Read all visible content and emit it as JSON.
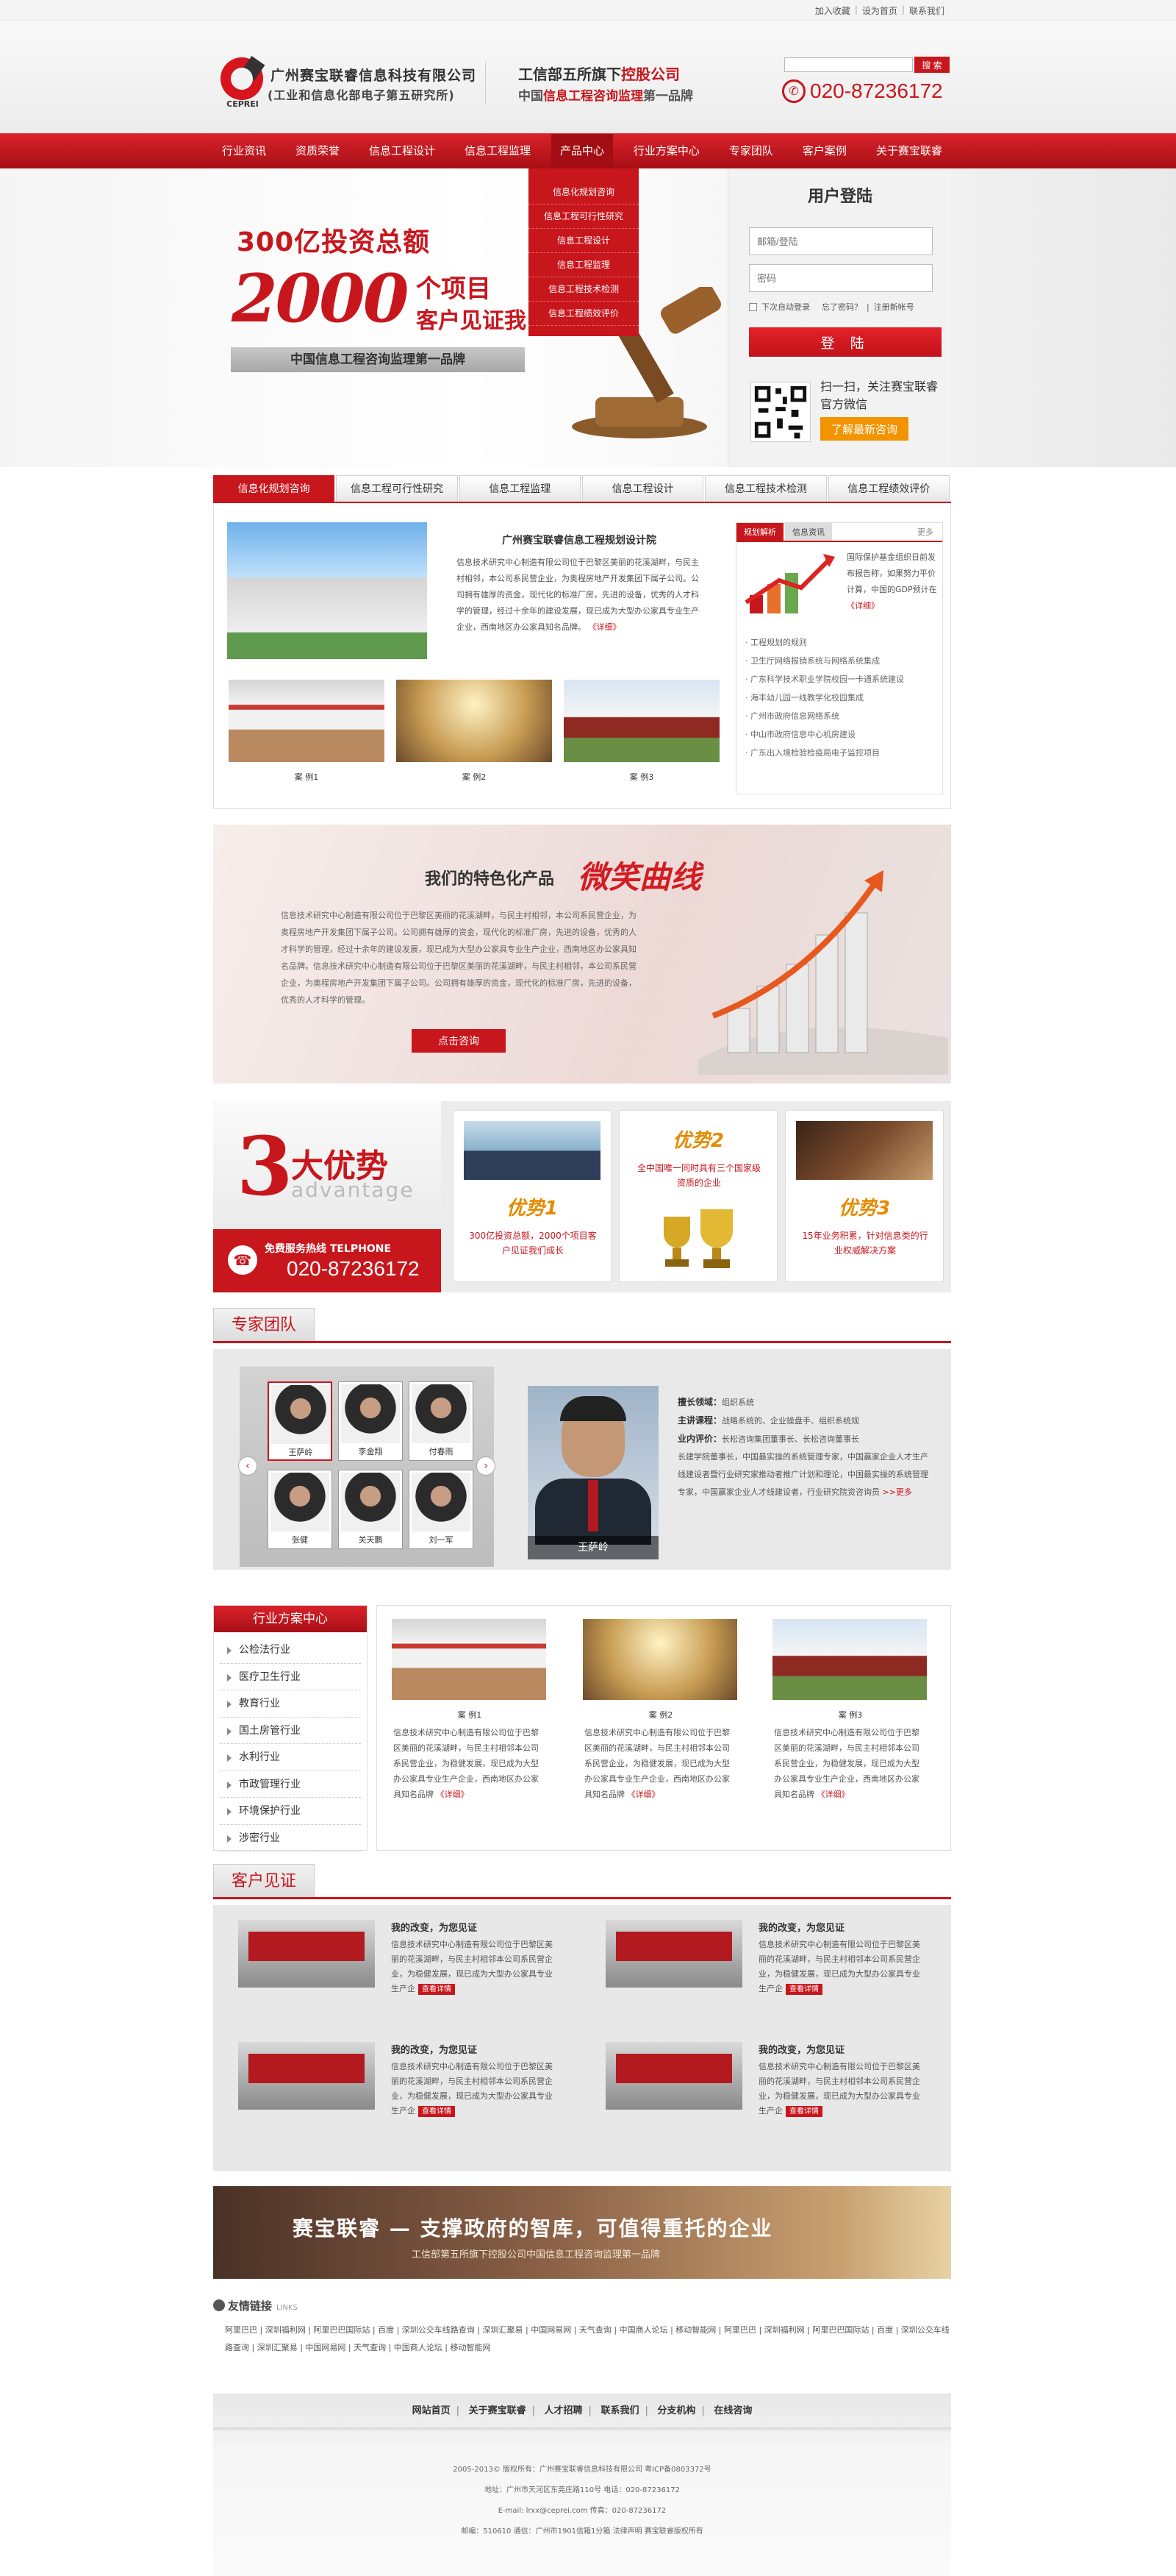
{
  "topbar": {
    "links": [
      "加入收藏",
      "设为首页",
      "联系我们"
    ]
  },
  "header": {
    "logo_abbr": "CEPREI",
    "company_name": "广州赛宝联睿信息科技有限公司",
    "company_sub": "(工业和信息化部电子第五研究所)",
    "slogan_line1_a": "工信部五所旗下",
    "slogan_line1_b": "控股公司",
    "slogan_line2_a": "中国",
    "slogan_line2_b": "信息工程咨询监理",
    "slogan_line2_c": "第一品牌",
    "search_button": "搜 索",
    "phone": "020-87236172"
  },
  "nav": {
    "items": [
      "行业资讯",
      "资质荣誉",
      "信息工程设计",
      "信息工程监理",
      "产品中心",
      "行业方案中心",
      "专家团队",
      "客户案例",
      "关于赛宝联睿"
    ],
    "active_index": 4
  },
  "dropdown": {
    "items": [
      "信息化规划咨询",
      "信息工程可行性研究",
      "信息工程设计",
      "信息工程监理",
      "信息工程技术检测",
      "信息工程绩效评价"
    ]
  },
  "banner": {
    "line1": "300亿投资总额",
    "big_number": "2000",
    "line2": "个项目",
    "line3_a": "客户见",
    "line3_b": "证我",
    "bar_text": "中国信息工程咨询监理第一品牌"
  },
  "login": {
    "title": "用户登陆",
    "username_placeholder": "邮箱/登陆",
    "password_placeholder": "密码",
    "remember": "下次自动登录",
    "forgot": "忘了密码？",
    "register": "注册新帐号",
    "submit": "登 陆",
    "qr_text": "扫一扫，关注赛宝联睿官方微信",
    "qr_button": "了解最新咨询"
  },
  "service_tabs": {
    "items": [
      "信息化规划咨询",
      "信息工程可行性研究",
      "信息工程监理",
      "信息工程设计",
      "信息工程技术检测",
      "信息工程绩效评价"
    ],
    "active_index": 0
  },
  "info": {
    "title": "广州赛宝联睿信息工程规划设计院",
    "text": "信息技术研究中心制造有限公司位于巴黎区美丽的花溪湖畔，与民主村相邻，本公司系民营企业，为奥程房地产开发集团下属子公司。公司拥有雄厚的资金，现代化的标准厂房，先进的设备，优秀的人才科学的管理，经过十余年的建设发展，现已成为大型办公家具专业生产企业，西南地区办公家具知名品牌。",
    "more": "《详细》",
    "cases": [
      "案 例1",
      "案 例2",
      "案 例3"
    ]
  },
  "news": {
    "tabs": [
      "规划解析",
      "信息资讯"
    ],
    "tab_more": "更多",
    "intro": "国际保护基金组织日前发布报告称，如果努力平价计算，中国的GDP预计在",
    "intro_more": "《详细》",
    "items": [
      "工程规划的规则",
      "卫生厅网络报销系统与网络系统集成",
      "广东科学技术职业学院校园一卡通系统建设",
      "海丰幼儿园一线教学化校园集成",
      "广州市政府信息网络系统",
      "中山市政府信息中心机房建设",
      "广东出入境检验检疫局电子监控项目"
    ]
  },
  "smile": {
    "title": "我们的特色化产品",
    "big": "微笑曲线",
    "text": "信息技术研究中心制造有限公司位于巴黎区美丽的花溪湖畔，与民主村相邻，本公司系民营企业，为奥程房地产开发集团下属子公司。公司拥有雄厚的资金，现代化的标准厂房，先进的设备，优秀的人才科学的管理，经过十余年的建设发展，现已成为大型办公家具专业生产企业，西南地区办公家具知名品牌。信息技术研究中心制造有限公司位于巴黎区美丽的花溪湖畔，与民主村相邻，本公司系民营企业，为奥程房地产开发集团下属子公司。公司拥有雄厚的资金，现代化的标准厂房，先进的设备，优秀的人才科学的管理。",
    "button": "点击咨询"
  },
  "advantages": {
    "num": "3",
    "title": "大优势",
    "en": "advantage",
    "hotline_label": "免费服务热线 TELPHONE",
    "hotline": "020-87236172",
    "items": [
      {
        "title": "优势1",
        "text": "300亿投资总额，2000个项目客户见证我们成长"
      },
      {
        "title": "优势2",
        "text": "全中国唯一同时具有三个国家级资质的企业"
      },
      {
        "title": "优势3",
        "text": "15年业务积累，针对信息类的行业权威解决方案"
      }
    ]
  },
  "experts": {
    "section_title": "专家团队",
    "thumbs": [
      "王萨岭",
      "李金翔",
      "付春雨",
      "张健",
      "关天鹏",
      "刘一军"
    ],
    "featured_name": "王萨岭",
    "field_label": "擅长领域：",
    "field": "组织系统",
    "courses_label": "主讲课程：",
    "courses": "战略系统的、企业操盘手、组织系统规",
    "title_label": "业内评价：",
    "title_text": "长松咨询集团董事长、长松咨询董事长",
    "bio": "长建学院董事长，中国最实操的系统管理专家，中国赢家企业人才生产线建设者暨行业研究家推动者推广计划和理论，中国最实操的系统管理专家，中国赢家企业人才线建设者，行业研究院资咨询员",
    "more": ">>更多"
  },
  "industries": {
    "title": "行业方案中心",
    "items": [
      "公检法行业",
      "医疗卫生行业",
      "教育行业",
      "国土房管行业",
      "水利行业",
      "市政管理行业",
      "环境保护行业",
      "涉密行业"
    ],
    "cases": [
      {
        "label": "案 例1",
        "text": "信息技术研究中心制造有限公司位于巴黎区美丽的花溪湖畔，与民主村相邻本公司系民营企业，为稳健发展，现已成为大型办公家具专业生产企业，西南地区办公家具知名品牌"
      },
      {
        "label": "案 例2",
        "text": "信息技术研究中心制造有限公司位于巴黎区美丽的花溪湖畔，与民主村相邻本公司系民营企业，为稳健发展，现已成为大型办公家具专业生产企业，西南地区办公家具知名品牌"
      },
      {
        "label": "案 例3",
        "text": "信息技术研究中心制造有限公司位于巴黎区美丽的花溪湖畔，与民主村相邻本公司系民营企业，为稳健发展，现已成为大型办公家具专业生产企业，西南地区办公家具知名品牌"
      }
    ],
    "more": "《详细》"
  },
  "testimonials": {
    "section_title": "客户见证",
    "items": [
      {
        "title": "我的改变，为您见证",
        "text": "信息技术研究中心制造有限公司位于巴黎区美丽的花溪湖畔，与民主村相邻本公司系民营企业，为稳健发展，现已成为大型办公家具专业生产企"
      },
      {
        "title": "我的改变，为您见证",
        "text": "信息技术研究中心制造有限公司位于巴黎区美丽的花溪湖畔，与民主村相邻本公司系民营企业，为稳健发展，现已成为大型办公家具专业生产企"
      },
      {
        "title": "我的改变，为您见证",
        "text": "信息技术研究中心制造有限公司位于巴黎区美丽的花溪湖畔，与民主村相邻本公司系民营企业，为稳健发展，现已成为大型办公家具专业生产企"
      },
      {
        "title": "我的改变，为您见证",
        "text": "信息技术研究中心制造有限公司位于巴黎区美丽的花溪湖畔，与民主村相邻本公司系民营企业，为稳健发展，现已成为大型办公家具专业生产企"
      }
    ],
    "button": "查看详情"
  },
  "bottom_banner": {
    "title": "赛宝联睿 — 支撑政府的智库，可值得重托的企业",
    "sub": "工信部第五所旗下控股公司中国信息工程咨询监理第一品牌"
  },
  "links": {
    "title": "友情链接",
    "en": "LINKS",
    "text": "阿里巴巴 | 深圳福利网 | 阿里巴巴国际站 | 百度 | 深圳公交车线路查询 | 深圳汇聚易 | 中国网易网 | 天气查询 | 中国商人论坛 | 移动智能网 | 阿里巴巴 | 深圳福利网 | 阿里巴巴国际站 | 百度 | 深圳公交车线路查询 | 深圳汇聚易 | 中国网易网 | 天气查询 | 中国商人论坛 | 移动智能网"
  },
  "footer": {
    "nav": [
      "网站首页",
      "关于赛宝联睿",
      "人才招聘",
      "联系我们",
      "分支机构",
      "在线咨询"
    ],
    "lines": [
      "2005-2013© 版权所有：广州赛宝联睿信息科技有限公司    粤ICP备0803372号",
      "地址：广州市天河区东莞庄路110号    电话：020-87236172",
      "E-mail: lrxx@ceprei.com    传真：020-87236172",
      "邮编：510610    通信：广州市1901信箱1分箱    法律声明  赛宝联睿版权所有"
    ]
  },
  "colors": {
    "brand_red": "#c8161d",
    "accent_orange": "#f29400"
  }
}
